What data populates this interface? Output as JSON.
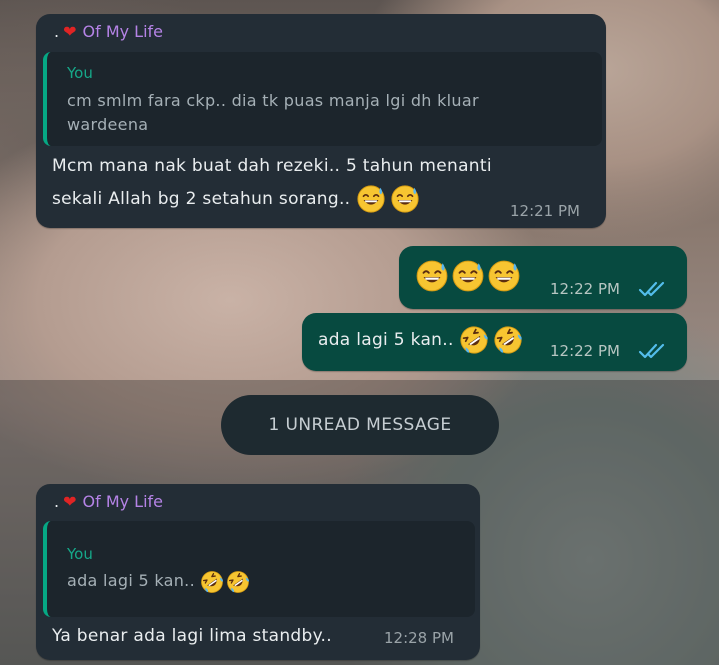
{
  "chat": {
    "sender_name": "Of My Life",
    "sender_prefix": ".",
    "you_label": "You",
    "unread_divider": "1 UNREAD MESSAGE",
    "messages": [
      {
        "direction": "incoming",
        "quote_text_line1": "cm smlm fara ckp.. dia tk puas manja lgi dh kluar",
        "quote_text_line2": "wardeena",
        "text_line1": "Mcm mana nak buat dah rezeki.. 5 tahun menanti",
        "text_line2": "sekali Allah bg 2 setahun sorang..",
        "emojis": [
          "grinning-sweat-emoji",
          "grinning-sweat-emoji"
        ],
        "time": "12:21 PM"
      },
      {
        "direction": "outgoing",
        "text": "",
        "emojis": [
          "grinning-sweat-emoji",
          "grinning-sweat-emoji",
          "grinning-sweat-emoji"
        ],
        "time": "12:22 PM",
        "status": "read"
      },
      {
        "direction": "outgoing",
        "text": "ada lagi 5 kan..",
        "emojis": [
          "rolling-laugh-emoji",
          "rolling-laugh-emoji"
        ],
        "time": "12:22 PM",
        "status": "read"
      },
      {
        "direction": "incoming",
        "quote_text": "ada lagi 5 kan..",
        "quote_emojis": [
          "rolling-laugh-emoji",
          "rolling-laugh-emoji"
        ],
        "text": "Ya benar ada lagi lima standby..",
        "time": "12:28 PM"
      }
    ]
  },
  "colors": {
    "incoming_bubble": "#232d36",
    "outgoing_bubble": "#074a40",
    "sender_name": "#b583e6",
    "quote_accent": "#06a884",
    "read_ticks": "#53bdeb"
  }
}
